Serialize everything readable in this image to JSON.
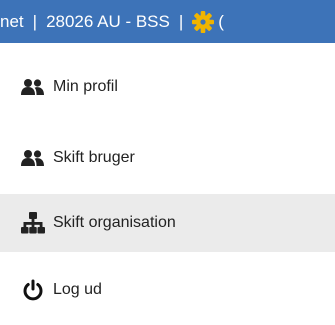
{
  "header": {
    "segment_left": "net",
    "separator": "|",
    "org_code": "28026 AU - BSS",
    "separator2": "|",
    "trailing": "(",
    "background_color": "#3d73b8",
    "text_color": "#ffffff"
  },
  "menu": {
    "items": [
      {
        "label": "Min profil",
        "icon": "users-icon",
        "active": false
      },
      {
        "label": "Skift bruger",
        "icon": "users-icon",
        "active": false
      },
      {
        "label": "Skift organisation",
        "icon": "org-hierarchy-icon",
        "active": true
      },
      {
        "label": "Log ud",
        "icon": "power-icon",
        "active": false
      }
    ],
    "hover_background": "#ebebeb"
  }
}
